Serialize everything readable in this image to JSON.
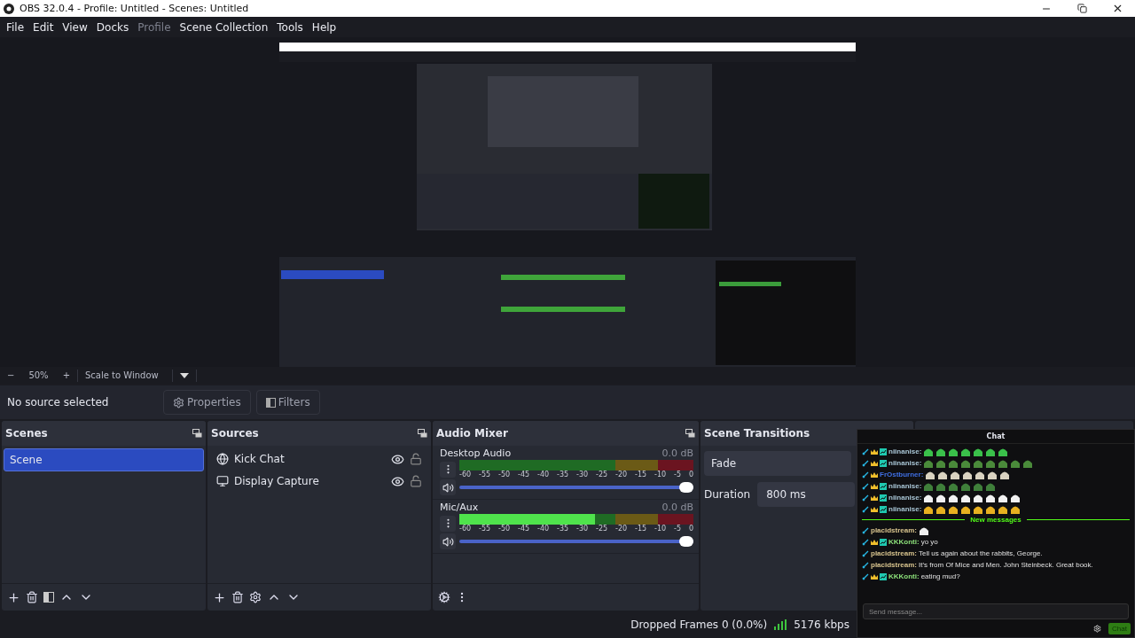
{
  "window": {
    "title": "OBS 32.0.4 - Profile: Untitled - Scenes: Untitled"
  },
  "menu": [
    {
      "label": "File",
      "disabled": false
    },
    {
      "label": "Edit",
      "disabled": false
    },
    {
      "label": "View",
      "disabled": false
    },
    {
      "label": "Docks",
      "disabled": false
    },
    {
      "label": "Profile",
      "disabled": true
    },
    {
      "label": "Scene Collection",
      "disabled": false
    },
    {
      "label": "Tools",
      "disabled": false
    },
    {
      "label": "Help",
      "disabled": false
    }
  ],
  "preview": {
    "kind": "picture",
    "zoom": "50%",
    "zoom_minus": "−",
    "zoom_plus": "+",
    "scale_mode": "Scale to Window"
  },
  "source_bar": {
    "status": "No source selected",
    "buttons": [
      "Properties",
      "Filters"
    ]
  },
  "scenes": {
    "title": "Scenes",
    "items": [
      {
        "label": "Scene",
        "selected": true
      }
    ]
  },
  "sources": {
    "title": "Sources",
    "items": [
      {
        "label": "Kick Chat",
        "kind": "browser",
        "visible": true,
        "locked": false
      },
      {
        "label": "Display Capture",
        "kind": "display",
        "visible": true,
        "locked": false
      }
    ]
  },
  "audio_mixer": {
    "title": "Audio Mixer",
    "channels": [
      {
        "name": "Desktop Audio",
        "reading": "0.0 dB",
        "level": 0,
        "volume": {
          "level": 1
        },
        "muted": false,
        "ticks": [
          "-60",
          "-55",
          "-50",
          "-45",
          "-40",
          "-35",
          "-30",
          "-25",
          "-20",
          "-15",
          "-10",
          "-5",
          "0"
        ]
      },
      {
        "name": "Mic/Aux",
        "reading": "0.0 dB",
        "level": 0.58,
        "volume": {
          "level": 1
        },
        "muted": false,
        "ticks": [
          "-60",
          "-55",
          "-50",
          "-45",
          "-40",
          "-35",
          "-30",
          "-25",
          "-20",
          "-15",
          "-10",
          "-5",
          "0"
        ]
      }
    ]
  },
  "transitions": {
    "title": "Scene Transitions",
    "transition": "Fade",
    "duration_label": "Duration",
    "duration": "800 ms"
  },
  "status_bar": {
    "dropped": "Dropped Frames 0 (0.0%)",
    "bitrate": "5176 kbps"
  },
  "chat": {
    "title": "Chat",
    "placeholder": "Send message...",
    "send": "Chat",
    "messages": [
      {
        "kind": "message",
        "user": "niinanise:",
        "color": "#a9c6d6",
        "moderator": true,
        "vip": true,
        "subscriber": true,
        "emotes": [
          {
            "color": "#3ac04a"
          },
          {
            "color": "#3ac04a"
          },
          {
            "color": "#3ac04a"
          },
          {
            "color": "#3ac04a"
          },
          {
            "color": "#3ac04a"
          },
          {
            "color": "#3ac04a"
          },
          {
            "color": "#3ac04a"
          }
        ]
      },
      {
        "kind": "message",
        "user": "niinanise:",
        "color": "#a9c6d6",
        "moderator": true,
        "vip": true,
        "subscriber": true,
        "emotes": [
          {
            "color": "#4a8a3a"
          },
          {
            "color": "#4a8a3a"
          },
          {
            "color": "#4a8a3a"
          },
          {
            "color": "#4a8a3a"
          },
          {
            "color": "#4a8a3a"
          },
          {
            "color": "#4a8a3a"
          },
          {
            "color": "#4a8a3a"
          },
          {
            "color": "#4a8a3a"
          },
          {
            "color": "#4a8a3a"
          }
        ]
      },
      {
        "kind": "message",
        "user": "FrOstburner:",
        "color": "#3f6fe3",
        "moderator": true,
        "vip": true,
        "subscriber": false,
        "emotes": [
          {
            "color": "#d9d2c0"
          },
          {
            "color": "#d9d2c0"
          },
          {
            "color": "#d9d2c0"
          },
          {
            "color": "#d9d2c0"
          },
          {
            "color": "#d9d2c0"
          },
          {
            "color": "#d9d2c0"
          },
          {
            "color": "#d9d2c0"
          }
        ]
      },
      {
        "kind": "message",
        "user": "niinanise:",
        "color": "#a9c6d6",
        "moderator": true,
        "vip": true,
        "subscriber": true,
        "emotes": [
          {
            "color": "#3f7f3a"
          },
          {
            "color": "#3f7f3a"
          },
          {
            "color": "#3f7f3a"
          },
          {
            "color": "#3f7f3a"
          },
          {
            "color": "#3f7f3a"
          },
          {
            "color": "#3f7f3a"
          }
        ]
      },
      {
        "kind": "message",
        "user": "niinanise:",
        "color": "#a9c6d6",
        "moderator": true,
        "vip": true,
        "subscriber": true,
        "emotes": [
          {
            "color": "#f2f2f2"
          },
          {
            "color": "#f2f2f2"
          },
          {
            "color": "#f2f2f2"
          },
          {
            "color": "#f2f2f2"
          },
          {
            "color": "#f2f2f2"
          },
          {
            "color": "#f2f2f2"
          },
          {
            "color": "#f2f2f2"
          },
          {
            "color": "#f2f2f2"
          }
        ]
      },
      {
        "kind": "message",
        "user": "niinanise:",
        "color": "#a9c6d6",
        "moderator": true,
        "vip": true,
        "subscriber": true,
        "emotes": [
          {
            "color": "#e8b020"
          },
          {
            "color": "#e8b020"
          },
          {
            "color": "#e8b020"
          },
          {
            "color": "#e8b020"
          },
          {
            "color": "#e8b020"
          },
          {
            "color": "#e8b020"
          },
          {
            "color": "#e8b020"
          },
          {
            "color": "#e8b020"
          }
        ]
      },
      {
        "kind": "divider",
        "text": "New messages"
      },
      {
        "kind": "message",
        "user": "placidstream:",
        "color": "#d8c48e",
        "moderator": true,
        "vip": false,
        "subscriber": false,
        "emotes": [
          {
            "color": "#eeeeee"
          }
        ]
      },
      {
        "kind": "message",
        "user": "KKKonti:",
        "color": "#8ce07a",
        "moderator": true,
        "vip": true,
        "subscriber": true,
        "text": "yo yo"
      },
      {
        "kind": "message",
        "user": "placidstream:",
        "color": "#d8c48e",
        "moderator": true,
        "vip": false,
        "subscriber": false,
        "text": "Tell us again about the rabbits, George."
      },
      {
        "kind": "message",
        "user": "placidstream:",
        "color": "#d8c48e",
        "moderator": true,
        "vip": false,
        "subscriber": false,
        "text": "It's from Of Mice and Men. John Steinbeck. Great book."
      },
      {
        "kind": "message",
        "user": "KKKonti:",
        "color": "#8ce07a",
        "moderator": true,
        "vip": true,
        "subscriber": true,
        "text": "eating mud?"
      }
    ]
  }
}
